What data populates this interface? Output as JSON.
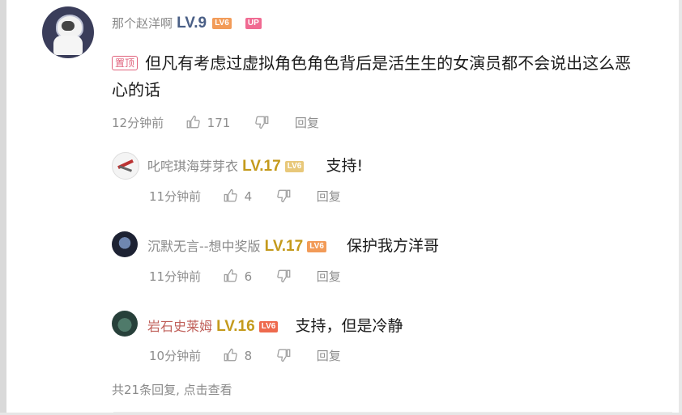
{
  "main_comment": {
    "username": "那个赵洋啊",
    "level": "LV.9",
    "level_tag": "LV6",
    "up_tag": "UP",
    "pinned_label": "置顶",
    "text_line1": "但凡有考虑过虚拟角色角色背后是活生生的女演员都不会说出这么恶",
    "text_line2": "心的话",
    "time": "12分钟前",
    "likes": "171",
    "reply_label": "回复"
  },
  "replies": [
    {
      "username": "叱咤琪海芽芽衣",
      "level": "LV.17",
      "level_tag": "LV6",
      "text": "支持!",
      "time": "11分钟前",
      "likes": "4",
      "reply_label": "回复"
    },
    {
      "username": "沉默无言--想中奖版",
      "level": "LV.17",
      "level_tag": "LV6",
      "text": "保护我方洋哥",
      "time": "11分钟前",
      "likes": "6",
      "reply_label": "回复"
    },
    {
      "username": "岩石史莱姆",
      "level": "LV.16",
      "level_tag": "LV6",
      "text": "支持，但是冷静",
      "time": "10分钟前",
      "likes": "8",
      "reply_label": "回复"
    }
  ],
  "footer": {
    "more_replies": "共21条回复, 点击查看"
  },
  "colors": {
    "level_blue": "#4a5f86",
    "level_gold": "#c49a1c",
    "pin_pink": "#e0627c",
    "meta_gray": "#8e8e8e"
  },
  "icons": {
    "like": "thumb-up-icon",
    "dislike": "thumb-down-icon"
  }
}
